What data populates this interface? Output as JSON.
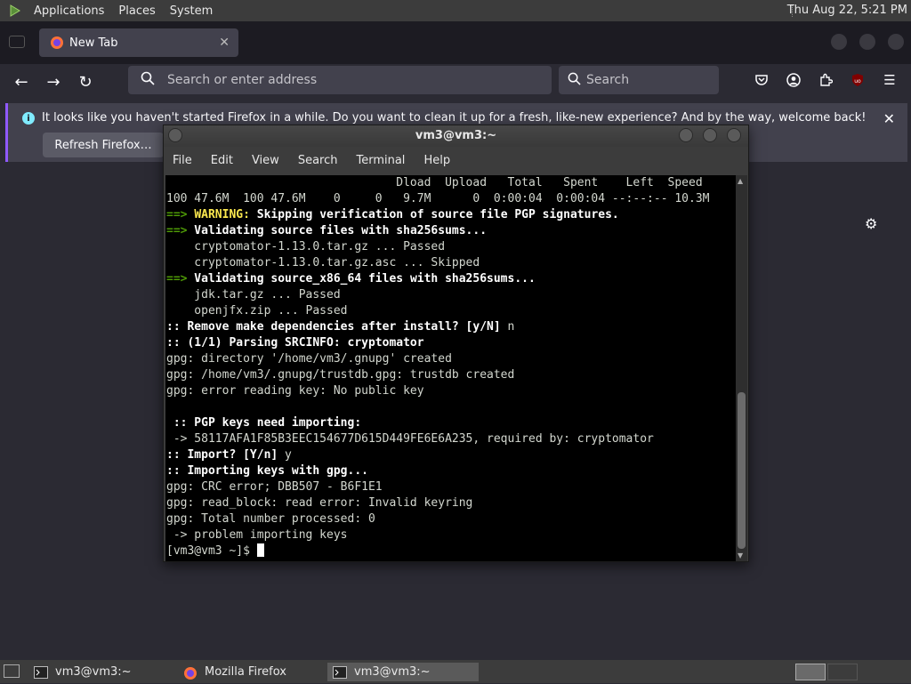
{
  "top_panel": {
    "menus": [
      "Applications",
      "Places",
      "System"
    ],
    "clock": "Thu Aug 22,  5:21 PM"
  },
  "firefox": {
    "tab_title": "New Tab",
    "url_placeholder": "Search or enter address",
    "search_placeholder": "Search",
    "notice_text": "It looks like you haven't started Firefox in a while. Do you want to clean it up for a fresh, like-new experience? And by the way, welcome back!",
    "refresh_button": "Refresh Firefox…",
    "accent": "#9059ff"
  },
  "terminal": {
    "title": "vm3@vm3:~",
    "menu": [
      "File",
      "Edit",
      "View",
      "Search",
      "Terminal",
      "Help"
    ],
    "lines": [
      {
        "parts": [
          {
            "t": "                                 Dload  Upload   Total   Spent    Left  Speed",
            "c": ""
          }
        ]
      },
      {
        "parts": [
          {
            "t": "100 47.6M  100 47.6M    0     0   9.7M      0  0:00:04  0:00:04 --:--:-- 10.3M",
            "c": ""
          }
        ]
      },
      {
        "parts": [
          {
            "t": "==> ",
            "c": "g"
          },
          {
            "t": "WARNING:",
            "c": "y"
          },
          {
            "t": " Skipping verification of source file PGP signatures.",
            "c": "b"
          }
        ]
      },
      {
        "parts": [
          {
            "t": "==>",
            "c": "g"
          },
          {
            "t": " Validating source files with sha256sums...",
            "c": "b"
          }
        ]
      },
      {
        "parts": [
          {
            "t": "    cryptomator-1.13.0.tar.gz ... Passed",
            "c": ""
          }
        ]
      },
      {
        "parts": [
          {
            "t": "    cryptomator-1.13.0.tar.gz.asc ... Skipped",
            "c": ""
          }
        ]
      },
      {
        "parts": [
          {
            "t": "==>",
            "c": "g"
          },
          {
            "t": " Validating source_x86_64 files with sha256sums...",
            "c": "b"
          }
        ]
      },
      {
        "parts": [
          {
            "t": "    jdk.tar.gz ... Passed",
            "c": ""
          }
        ]
      },
      {
        "parts": [
          {
            "t": "    openjfx.zip ... Passed",
            "c": ""
          }
        ]
      },
      {
        "parts": [
          {
            "t": ":: Remove make dependencies after install? [y/N]",
            "c": "b"
          },
          {
            "t": " n",
            "c": ""
          }
        ]
      },
      {
        "parts": [
          {
            "t": ":: (1/1) Parsing SRCINFO: cryptomator",
            "c": "b"
          }
        ]
      },
      {
        "parts": [
          {
            "t": "gpg: directory '/home/vm3/.gnupg' created",
            "c": ""
          }
        ]
      },
      {
        "parts": [
          {
            "t": "gpg: /home/vm3/.gnupg/trustdb.gpg: trustdb created",
            "c": ""
          }
        ]
      },
      {
        "parts": [
          {
            "t": "gpg: error reading key: No public key",
            "c": ""
          }
        ]
      },
      {
        "parts": [
          {
            "t": " ",
            "c": ""
          }
        ]
      },
      {
        "parts": [
          {
            "t": " :: PGP keys need importing:",
            "c": "b"
          }
        ]
      },
      {
        "parts": [
          {
            "t": " -> 58117AFA1F85B3EEC154677D615D449FE6E6A235, required by: cryptomator",
            "c": ""
          }
        ]
      },
      {
        "parts": [
          {
            "t": ":: Import? [Y/n]",
            "c": "b"
          },
          {
            "t": " y",
            "c": ""
          }
        ]
      },
      {
        "parts": [
          {
            "t": ":: Importing keys with gpg...",
            "c": "b"
          }
        ]
      },
      {
        "parts": [
          {
            "t": "gpg: CRC error; DBB507 - B6F1E1",
            "c": ""
          }
        ]
      },
      {
        "parts": [
          {
            "t": "gpg: read_block: read error: Invalid keyring",
            "c": ""
          }
        ]
      },
      {
        "parts": [
          {
            "t": "gpg: Total number processed: 0",
            "c": ""
          }
        ]
      },
      {
        "parts": [
          {
            "t": " -> problem importing keys",
            "c": ""
          }
        ]
      }
    ],
    "prompt": "[vm3@vm3 ~]$ "
  },
  "bottom_panel": {
    "tasks": [
      "vm3@vm3:~",
      "Mozilla Firefox",
      "vm3@vm3:~"
    ]
  }
}
